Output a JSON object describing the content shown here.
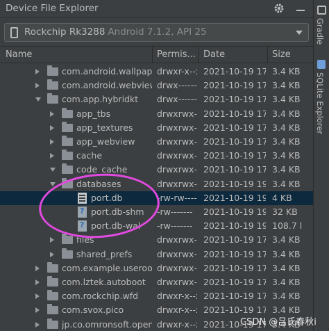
{
  "panel": {
    "title": "Device File Explorer",
    "icons": [
      "gear-icon",
      "minimize-icon"
    ]
  },
  "device": {
    "name": "Rockchip Rk3288",
    "info": "Android 7.1.2, API 25"
  },
  "columns": [
    "Name",
    "Permis...",
    "Date",
    "Size"
  ],
  "rows": [
    {
      "name": "com.android.wallpap",
      "perm": "drwxr-x--x",
      "date": "2021-10-19 17:",
      "size": "3.4 KB",
      "depth": 0,
      "kind": "folder",
      "expander": "right"
    },
    {
      "name": "com.android.webview",
      "perm": "drwx------",
      "date": "2021-10-19 17:",
      "size": "3.4 KB",
      "depth": 0,
      "kind": "folder",
      "expander": "right"
    },
    {
      "name": "com.app.hybridkt",
      "perm": "drwx------",
      "date": "2021-10-19 17:",
      "size": "3.4 KB",
      "depth": 0,
      "kind": "folder",
      "expander": "down"
    },
    {
      "name": "app_tbs",
      "perm": "drwxrwx--x",
      "date": "2021-10-19 17:",
      "size": "3.4 KB",
      "depth": 1,
      "kind": "folder",
      "expander": "right"
    },
    {
      "name": "app_textures",
      "perm": "drwxrwx--x",
      "date": "2021-10-19 17:",
      "size": "3.4 KB",
      "depth": 1,
      "kind": "folder",
      "expander": "right"
    },
    {
      "name": "app_webview",
      "perm": "drwxrwx--x",
      "date": "2021-10-19 17:",
      "size": "3.4 KB",
      "depth": 1,
      "kind": "folder",
      "expander": "right"
    },
    {
      "name": "cache",
      "perm": "drwxrwx--x",
      "date": "2021-10-19 17:",
      "size": "3.4 KB",
      "depth": 1,
      "kind": "folder",
      "expander": "right"
    },
    {
      "name": "code_cache",
      "perm": "drwxrwx--x",
      "date": "2021-10-19 17:",
      "size": "3.4 KB",
      "depth": 1,
      "kind": "folder",
      "expander": "down"
    },
    {
      "name": "databases",
      "perm": "drwxrwx--x",
      "date": "2021-10-19 19:",
      "size": "3.4 KB",
      "depth": 1,
      "kind": "folder",
      "expander": "down"
    },
    {
      "name": "port.db",
      "perm": "-rw-rw----",
      "date": "2021-10-19 19:",
      "size": "4 KB",
      "depth": 2,
      "kind": "db",
      "expander": "none",
      "selected": true
    },
    {
      "name": "port.db-shm",
      "perm": "-rw-------",
      "date": "2021-10-19 19:",
      "size": "32 KB",
      "depth": 2,
      "kind": "unknown",
      "expander": "none"
    },
    {
      "name": "port.db-wal",
      "perm": "-rw-------",
      "date": "2021-10-19 19:",
      "size": "108.7 l",
      "depth": 2,
      "kind": "unknown",
      "expander": "none"
    },
    {
      "name": "files",
      "perm": "drwxrwx--x",
      "date": "2021-10-19 17:",
      "size": "3.4 KB",
      "depth": 1,
      "kind": "folder",
      "expander": "right"
    },
    {
      "name": "shared_prefs",
      "perm": "drwxrwx--x",
      "date": "2021-10-19 17:",
      "size": "3.4 KB",
      "depth": 1,
      "kind": "folder",
      "expander": "right"
    },
    {
      "name": "com.example.useroor",
      "perm": "drwxrwx--x",
      "date": "2021-10-19 17:",
      "size": "3.4 KB",
      "depth": 0,
      "kind": "folder",
      "expander": "right"
    },
    {
      "name": "com.lztek.autoboot",
      "perm": "drwxrwx--x",
      "date": "2021-10-19 17:",
      "size": "3.4 KB",
      "depth": 0,
      "kind": "folder",
      "expander": "right"
    },
    {
      "name": "com.rockchip.wfd",
      "perm": "drwxr-x--x",
      "date": "2021-10-19 17:",
      "size": "3.4 KB",
      "depth": 0,
      "kind": "folder",
      "expander": "right"
    },
    {
      "name": "com.svox.pico",
      "perm": "drwxr-x--x",
      "date": "2021-10-19 17:",
      "size": "3.4 KB",
      "depth": 0,
      "kind": "folder",
      "expander": "right"
    },
    {
      "name": "jp.co.omronsoft.open",
      "perm": "drwxr-x--x",
      "date": "2021-10-19 17:",
      "size": "3.4 KB",
      "depth": 0,
      "kind": "folder",
      "expander": "right"
    }
  ],
  "sidebar": {
    "tabs": [
      "Gradle",
      "SQLite Explorer"
    ]
  },
  "watermark": "CSDN @吕氏春秋i",
  "colors": {
    "background": "#3c3f41",
    "selection": "#0d293e",
    "annotation": "#e14ae0"
  }
}
